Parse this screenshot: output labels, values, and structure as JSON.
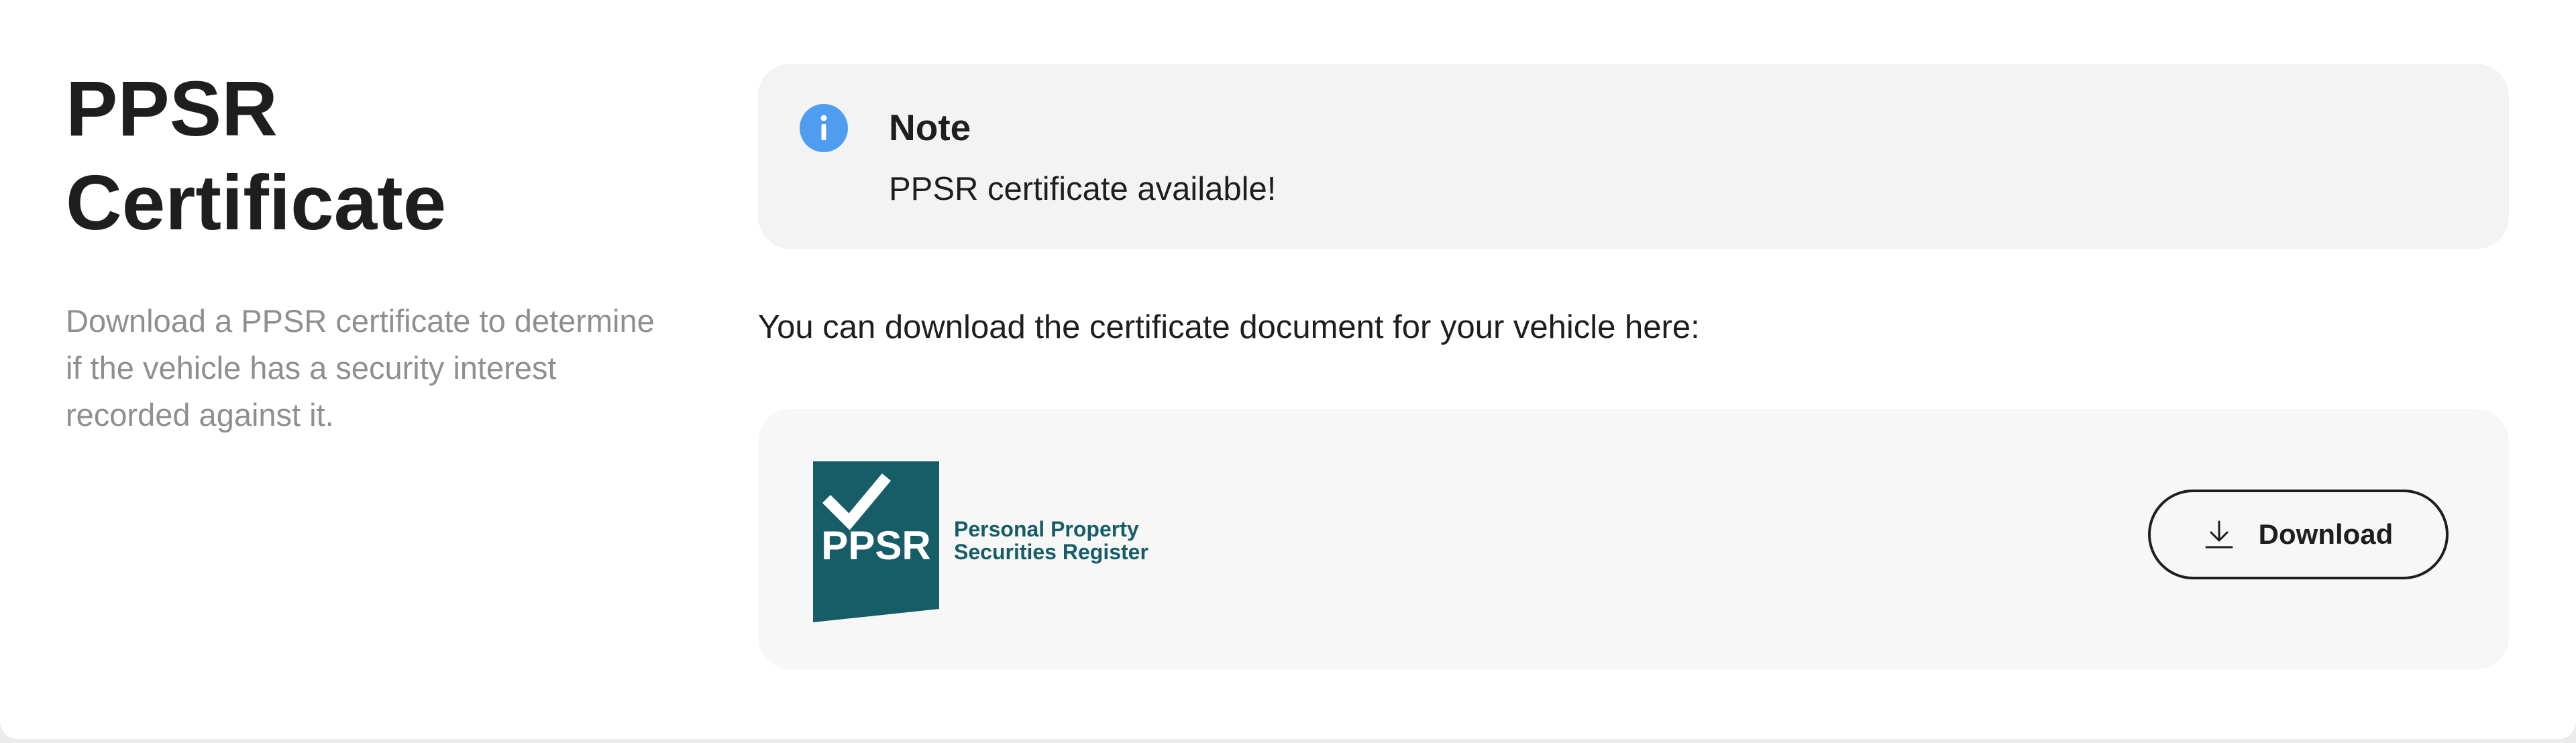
{
  "section": {
    "title": "PPSR Certificate",
    "description": "Download a PPSR certificate to determine if the vehicle has a security interest recorded against it."
  },
  "note": {
    "icon": "info-icon",
    "title": "Note",
    "text": "PPSR certificate available!"
  },
  "intro_text": "You can download the certificate document for your vehicle here:",
  "logo": {
    "mark_text": "PPSR",
    "line1": "Personal Property",
    "line2": "Securities Register"
  },
  "download": {
    "icon": "download-icon",
    "label": "Download"
  },
  "colors": {
    "info_blue": "#4f9df0",
    "ppsr_teal": "#175d68",
    "text_dark": "#1e1e1e",
    "text_muted": "#8f8f8f"
  }
}
